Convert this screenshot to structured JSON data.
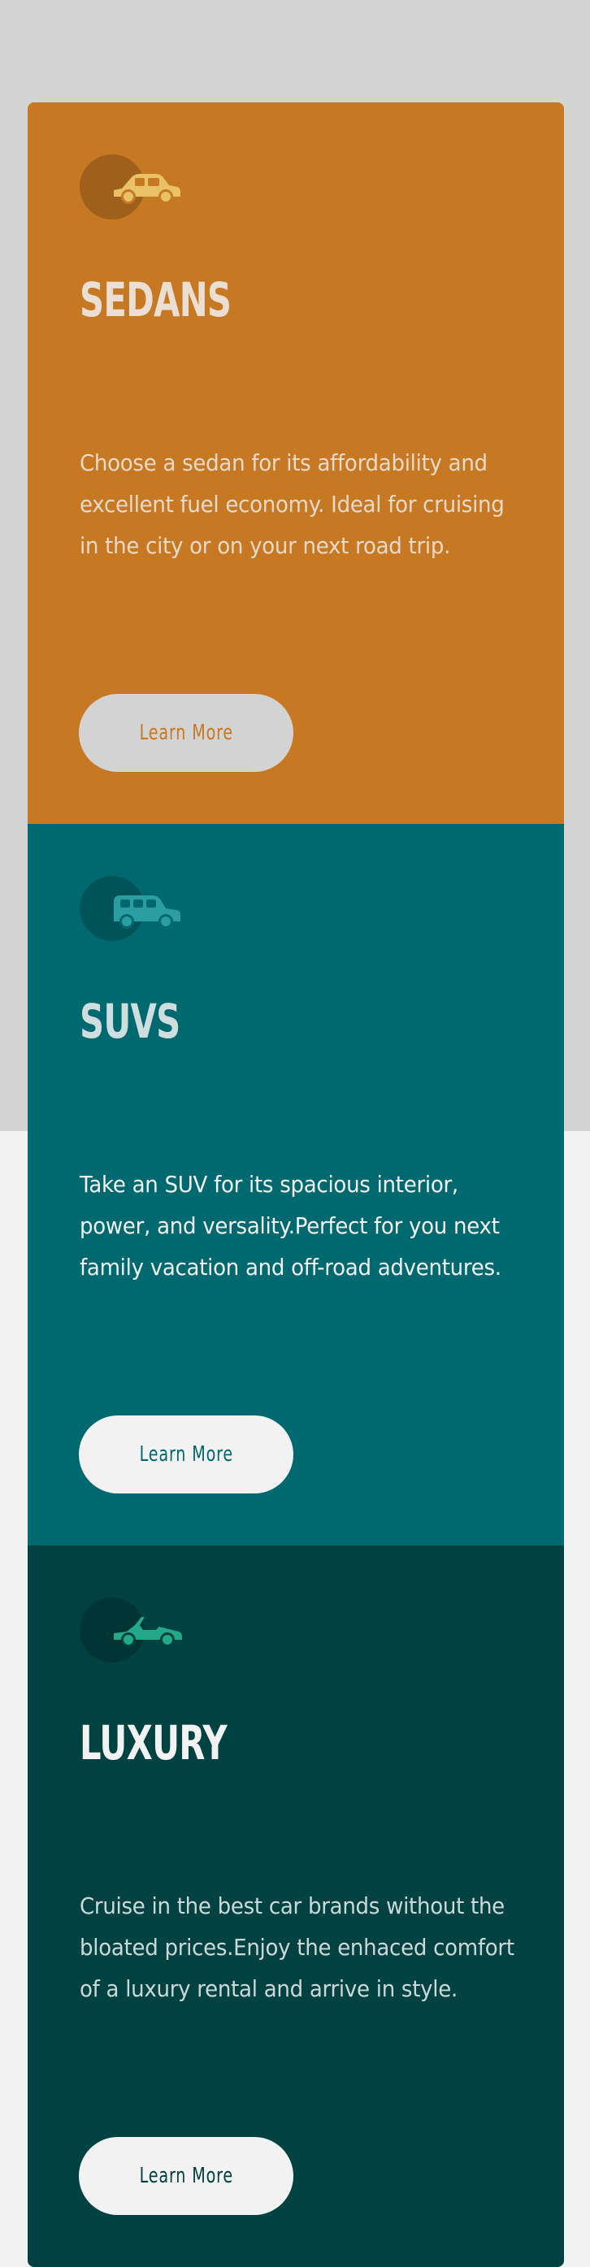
{
  "colors": {
    "sedans_bg": "#c77823",
    "suvs_bg": "#006970",
    "luxury_bg": "#004241",
    "text_light": "#f2f2f2",
    "button_bg_light": "#f2f2f2",
    "top_background": "#d3d3d3",
    "page_background": "#f2f2f2"
  },
  "cards": [
    {
      "title": "SEDANS",
      "icon": "sedan-car-icon",
      "description": "Choose a sedan for its affordability and excellent fuel economy. Ideal for cruising in the city or on your next road trip.",
      "button_label": "Learn More"
    },
    {
      "title": "SUVS",
      "icon": "suv-car-icon",
      "description": "Take an SUV for its spacious interior, power, and versality.Perfect for you next family vacation and off-road adventures.",
      "button_label": "Learn More"
    },
    {
      "title": "LUXURY",
      "icon": "convertible-car-icon",
      "description": "Cruise in the best car brands without the bloated prices.Enjoy the enhaced comfort of a luxury rental and arrive in style.",
      "button_label": "Learn More"
    }
  ]
}
